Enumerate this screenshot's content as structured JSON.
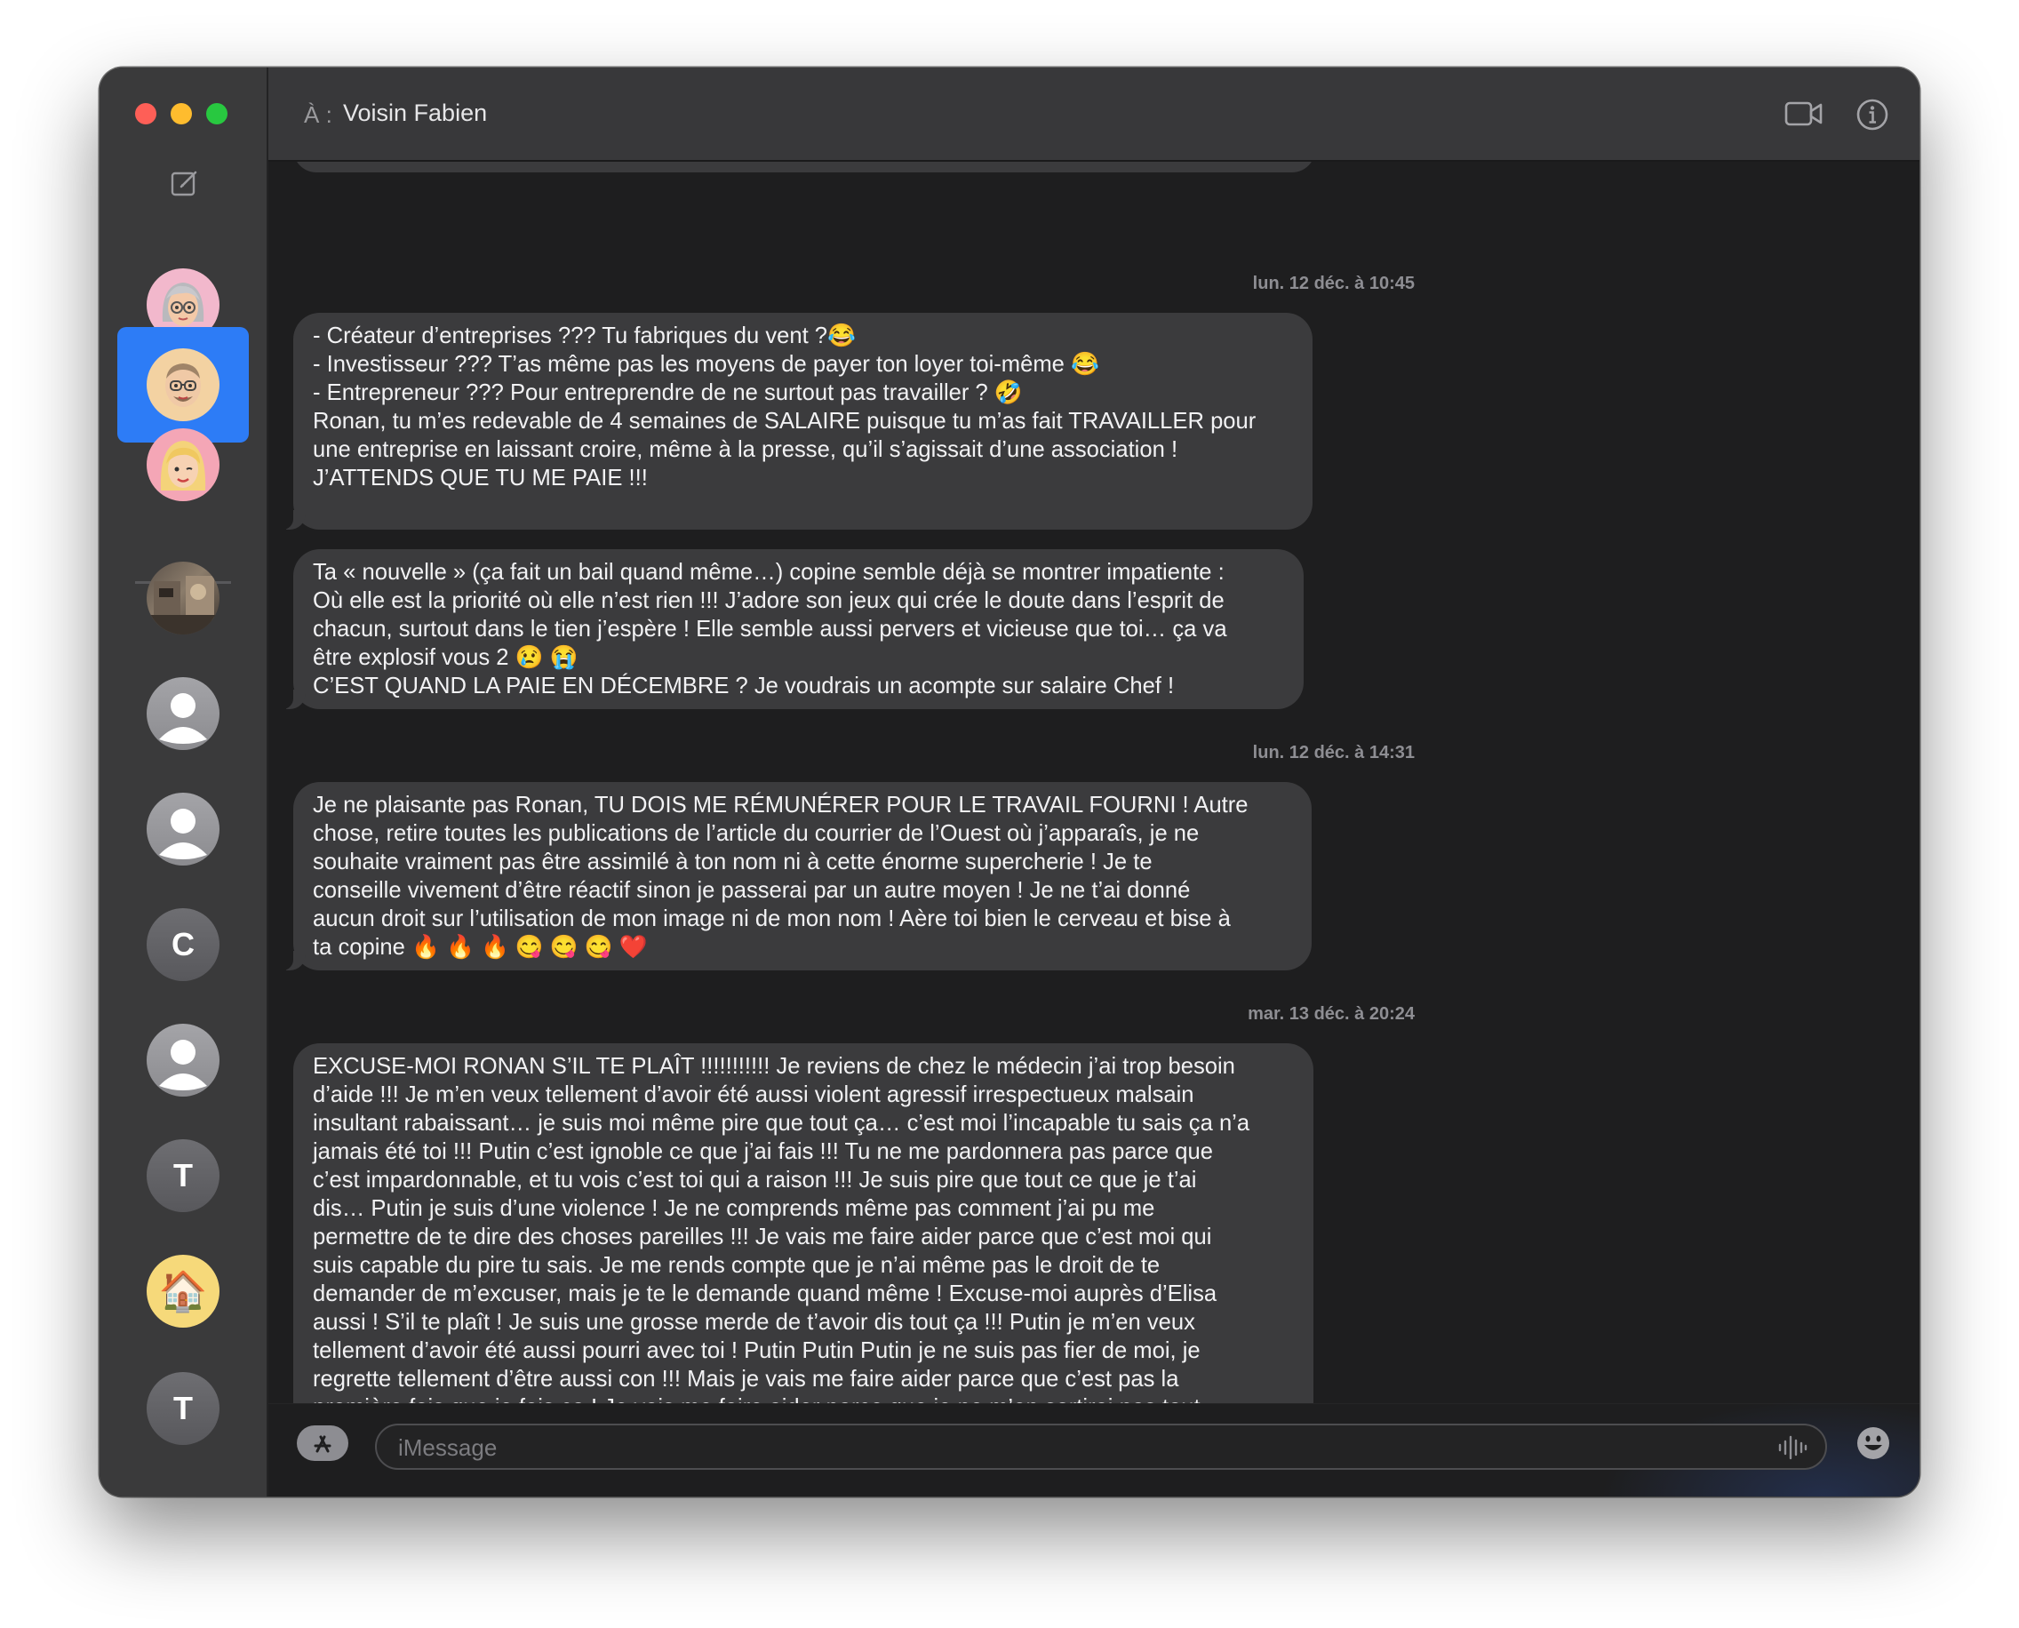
{
  "window": {
    "traffic_lights": [
      "close",
      "minimize",
      "zoom"
    ],
    "colors": {
      "close": "#fe5f57",
      "minimize": "#febc2e",
      "zoom": "#28c840",
      "selection": "#2d7cf6"
    }
  },
  "sidebar": {
    "compose_icon": "compose-icon",
    "conversations": [
      {
        "kind": "memoji",
        "icon": "memoji-gray-hair-glasses-icon",
        "selected": false
      },
      {
        "kind": "memoji",
        "icon": "memoji-bald-glasses-icon",
        "selected": true
      },
      {
        "kind": "memoji",
        "icon": "memoji-blonde-icon",
        "selected": false
      },
      {
        "kind": "photo",
        "icon": "photo-avatar-icon",
        "selected": false
      },
      {
        "kind": "generic",
        "icon": "person-icon",
        "selected": false
      },
      {
        "kind": "generic",
        "icon": "person-icon",
        "selected": false
      },
      {
        "kind": "letter",
        "letter": "C",
        "selected": false
      },
      {
        "kind": "generic",
        "icon": "person-icon",
        "selected": false
      },
      {
        "kind": "letter",
        "letter": "T",
        "selected": false
      },
      {
        "kind": "emoji",
        "emoji": "🏠",
        "selected": false
      },
      {
        "kind": "letter",
        "letter": "T",
        "selected": false
      }
    ]
  },
  "header": {
    "to_label": "À :",
    "recipient": "Voisin Fabien",
    "video_icon": "video-camera-icon",
    "info_icon": "info-icon"
  },
  "transcript": {
    "timestamps": [
      "lun. 12 déc. à 10:45",
      "lun. 12 déc. à 14:31",
      "mar. 13 déc. à 20:24"
    ],
    "messages": [
      "- Créateur d’entreprises ??? Tu fabriques du vent ?😂\n- Investisseur ??? T’as même pas les moyens de payer ton loyer toi-même 😂\n- Entrepreneur ??? Pour entreprendre de ne surtout pas travailler ? 🤣\nRonan, tu m’es redevable de 4 semaines de SALAIRE puisque tu m’as fait TRAVAILLER pour\nune entreprise en laissant croire, même à la presse, qu’il s’agissait d’une association !\nJ’ATTENDS QUE TU ME PAIE !!!\n",
      "Ta « nouvelle » (ça fait un bail quand même…) copine semble déjà se montrer impatiente :\nOù elle est la priorité où elle n’est rien !!! J’adore son jeux qui crée le doute dans l’esprit de\nchacun, surtout dans le tien j’espère ! Elle semble aussi pervers et vicieuse que toi… ça va\nêtre explosif vous 2 😢 😭\nC’EST QUAND LA PAIE EN DÉCEMBRE ? Je voudrais un acompte sur salaire Chef !",
      "Je ne plaisante pas Ronan, TU DOIS ME RÉMUNÉRER POUR LE TRAVAIL FOURNI ! Autre\nchose, retire toutes les publications de l’article du courrier de l’Ouest où j’apparaîs, je ne\nsouhaite vraiment pas être assimilé à ton nom ni à cette énorme supercherie ! Je te\nconseille vivement d’être réactif sinon je passerai par un autre moyen ! Je ne t’ai donné\naucun droit sur l’utilisation de mon image ni de mon nom ! Aère toi bien le cerveau et bise à\nta copine 🔥 🔥 🔥 😋 😋 😋 ❤️",
      "EXCUSE-MOI RONAN S’IL TE PLAÎT !!!!!!!!!!! Je reviens de chez le médecin j’ai trop besoin\nd’aide !!! Je m’en veux tellement d’avoir été aussi violent agressif irrespectueux malsain\ninsultant rabaissant… je suis moi même pire que tout ça… c’est moi l’incapable tu sais ça n’a\njamais été toi !!! Putin c’est ignoble ce que j’ai fais !!! Tu ne me pardonnera pas parce que\nc’est impardonnable, et tu vois c’est toi qui a raison !!! Je suis pire que tout ce que je t’ai\ndis… Putin je suis d’une violence ! Je ne comprends même pas comment j’ai pu me\npermettre de te dire des choses pareilles !!! Je vais me faire aider parce que c’est moi qui\nsuis capable du pire tu sais. Je me rends compte que je n’ai même pas le droit de te\ndemander de m’excuser, mais je te le demande quand même ! Excuse-moi auprès d’Elisa\naussi ! S’il te plaît ! Je suis une grosse merde de t’avoir dis tout ça !!! Putin je m’en veux\ntellement d’avoir été aussi pourri avec toi ! Putin Putin Putin je ne suis pas fier de moi, je\nregrette tellement d’être aussi con !!! Mais je vais me faire aider parce que c’est pas la\npremière fois que je fais ça ! Je vais me faire aider parce que je ne m’en sortirai pas tout\nseul !!! Ne doute pas de toi c’est moi qui a un problème Ronan !!!"
    ]
  },
  "composer": {
    "placeholder": "iMessage",
    "value": "",
    "apps_icon": "app-store-icon",
    "audio_icon": "audio-waveform-icon",
    "emoji_icon": "emoji-smiley-icon"
  }
}
